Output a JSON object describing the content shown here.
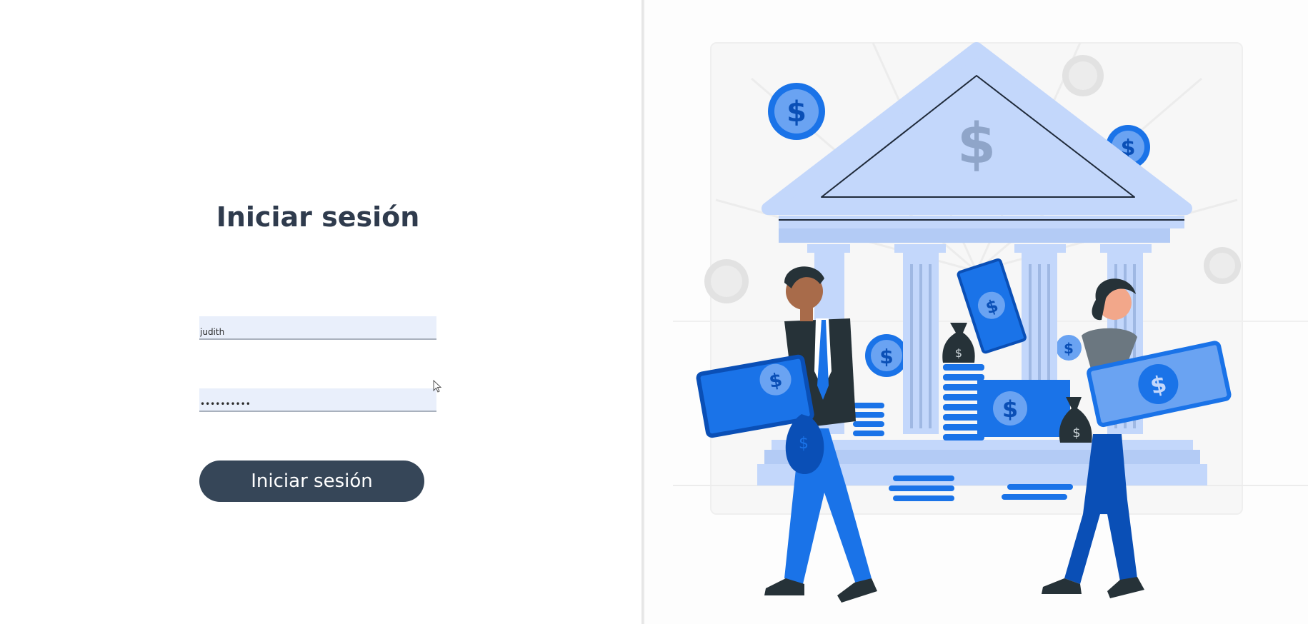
{
  "login": {
    "title": "Iniciar sesión",
    "username_value": "judith",
    "password_value": "••••••••••",
    "submit_label": "Iniciar sesión"
  },
  "illustration": {
    "subject": "bank-building-with-people-carrying-money",
    "colors": {
      "primary_blue": "#1a73e8",
      "light_blue": "#c3d7fb",
      "dark_blue": "#0a4fb6",
      "dark": "#263238"
    }
  },
  "theme": {
    "button_color": "#364658",
    "input_background": "#e9effb",
    "title_color": "#2f3b4d"
  }
}
